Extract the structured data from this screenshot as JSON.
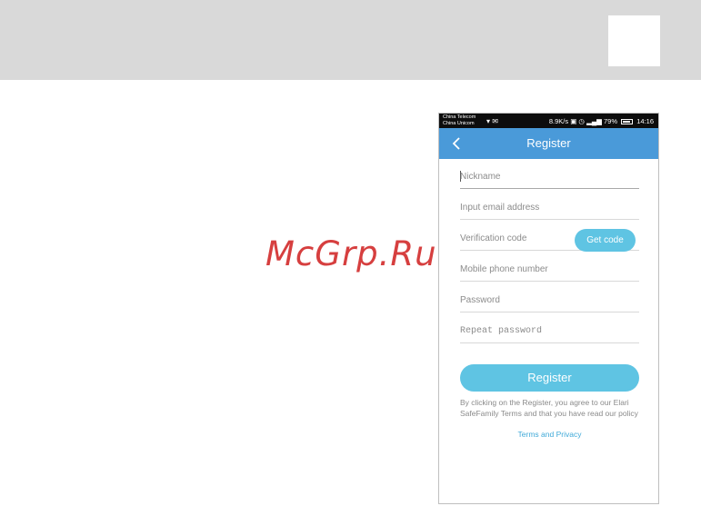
{
  "watermark": "McGrp.Ru",
  "status_bar": {
    "carrier_1": "China Telecom",
    "carrier_2": "China Unicom",
    "speed": "8.9K/s",
    "battery": "79%",
    "time": "14:16"
  },
  "app_bar": {
    "title": "Register"
  },
  "form": {
    "nickname_placeholder": "Nickname",
    "email_placeholder": "Input email address",
    "verification_placeholder": "Verification code",
    "get_code_label": "Get code",
    "phone_placeholder": "Mobile phone number",
    "password_placeholder": "Password",
    "repeat_password_placeholder": "Repeat password"
  },
  "register_label": "Register",
  "agreement_text": "By clicking on the Register, you agree to our Elari SafeFamily Terms and that you have read our policy",
  "terms_link": "Terms and Privacy"
}
